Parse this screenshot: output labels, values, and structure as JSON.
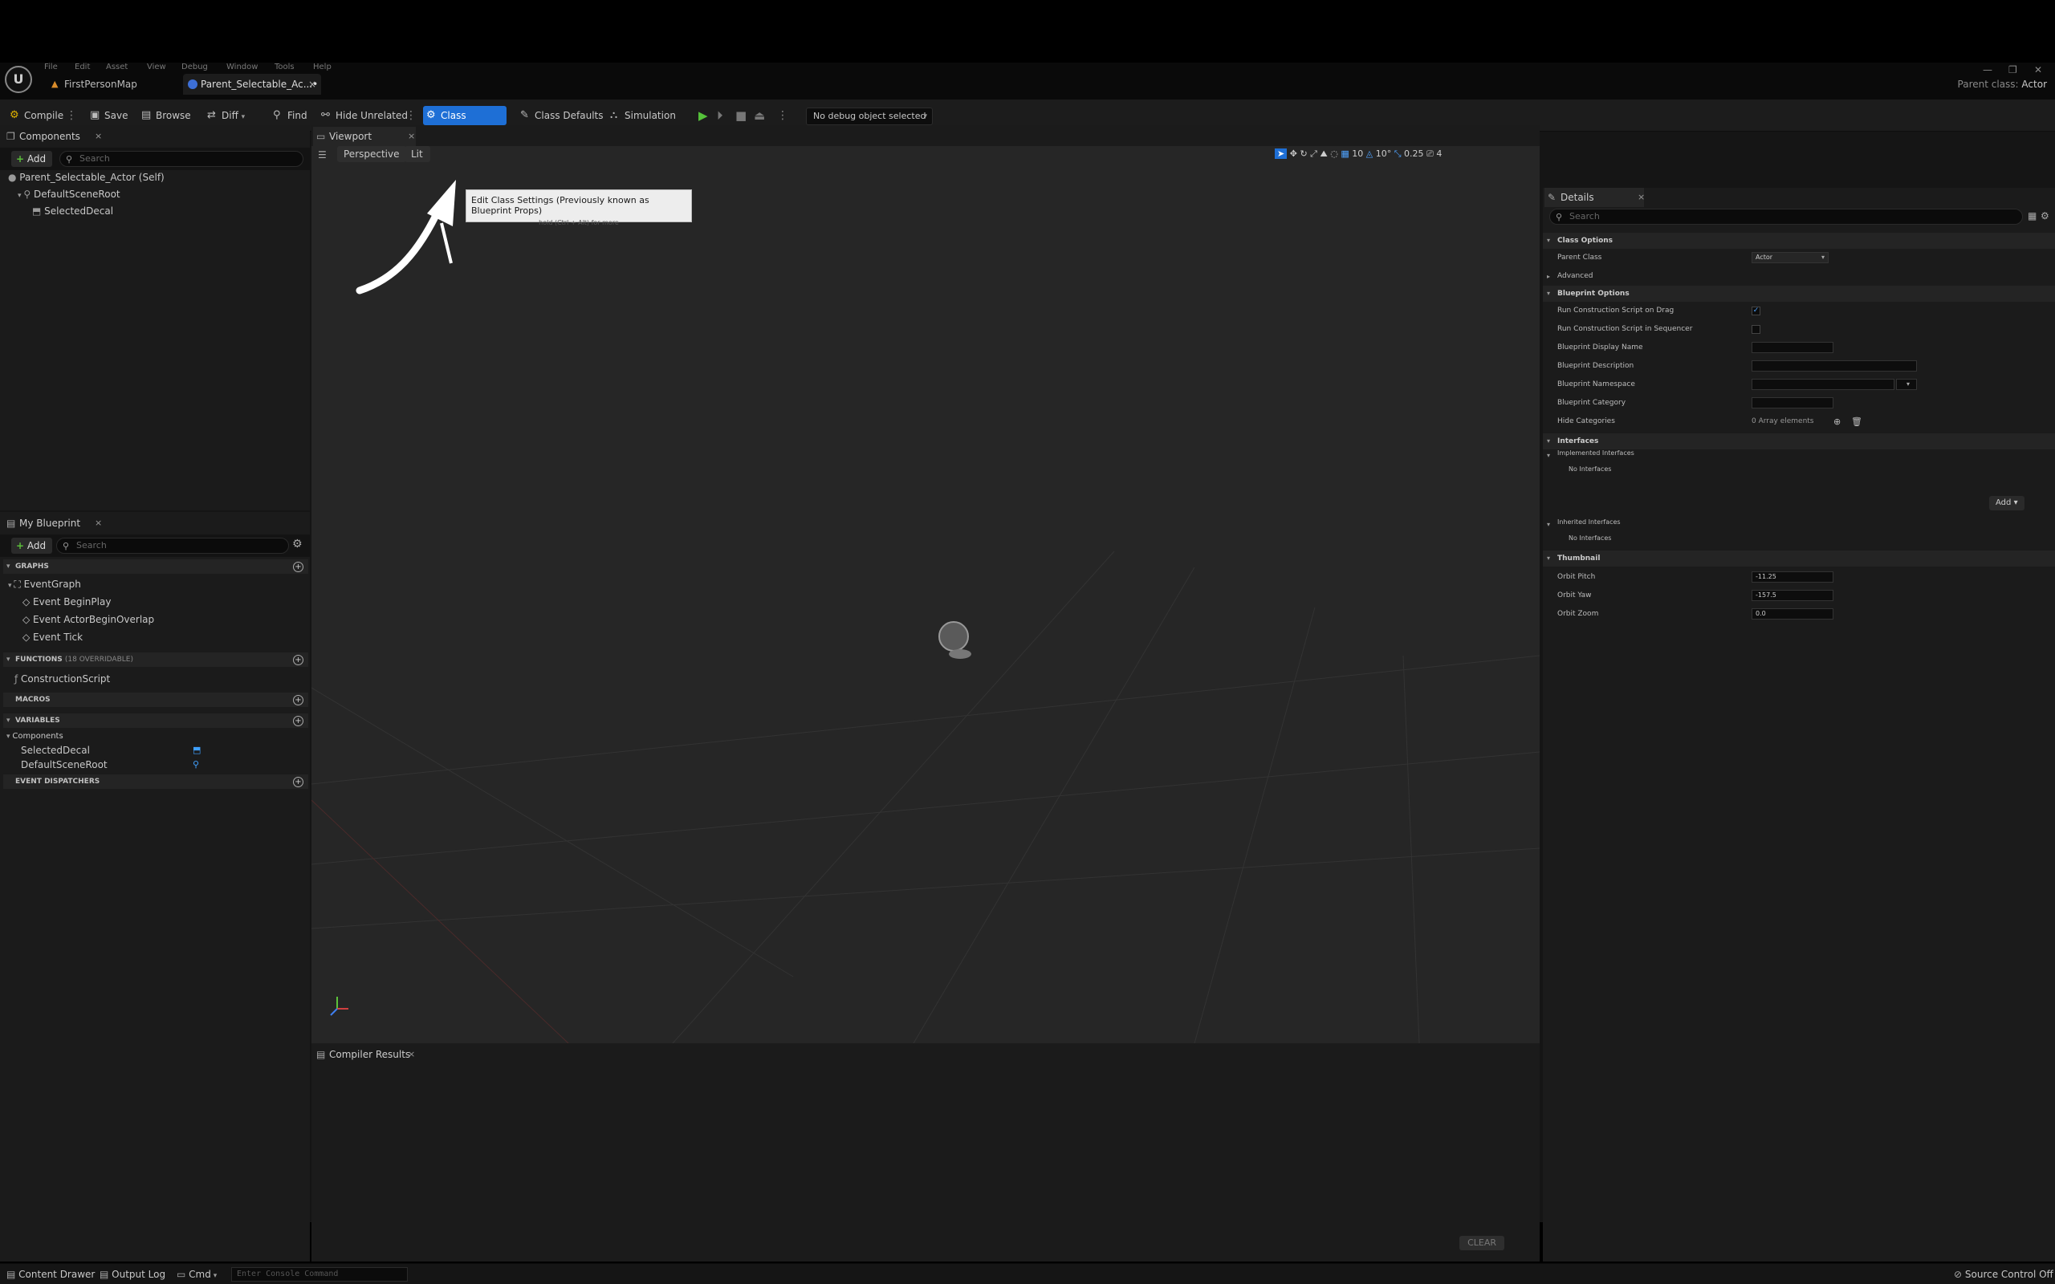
{
  "menu": [
    "File",
    "Edit",
    "Asset",
    "View",
    "Debug",
    "Window",
    "Tools",
    "Help"
  ],
  "tabs": [
    {
      "label": "FirstPersonMap"
    },
    {
      "label": "Parent_Selectable_Ac...•"
    }
  ],
  "window": {
    "minimize": "—",
    "maximize": "❐",
    "close": "✕"
  },
  "parent_class": {
    "label": "Parent class:",
    "value": "Actor"
  },
  "toolbar": {
    "compile": "Compile",
    "save": "Save",
    "browse": "Browse",
    "diff": "Diff",
    "find": "Find",
    "hide_unrelated": "Hide Unrelated",
    "class_settings": "Class Settings",
    "class_defaults": "Class Defaults",
    "simulation": "Simulation",
    "debug_select": "No debug object selected"
  },
  "tooltip": {
    "title": "Edit Class Settings (Previously known as Blueprint Props)",
    "hint": "hold (Ctrl + Alt) for more"
  },
  "components": {
    "tab": "Components",
    "add": "Add",
    "search_placeholder": "Search",
    "items": [
      "Parent_Selectable_Actor (Self)",
      "DefaultSceneRoot",
      "SelectedDecal"
    ]
  },
  "my_blueprint": {
    "tab": "My Blueprint",
    "add": "Add",
    "search_placeholder": "Search",
    "graphs": "GRAPHS",
    "event_graph": "EventGraph",
    "events": [
      "Event BeginPlay",
      "Event ActorBeginOverlap",
      "Event Tick"
    ],
    "functions": "FUNCTIONS",
    "functions_sub": "(18 OVERRIDABLE)",
    "construction": "ConstructionScript",
    "macros": "MACROS",
    "variables": "VARIABLES",
    "components_group": "Components",
    "vars": [
      "SelectedDecal",
      "DefaultSceneRoot"
    ],
    "dispatchers": "EVENT DISPATCHERS"
  },
  "viewport": {
    "tab": "Viewport",
    "perspective": "Perspective",
    "lit": "Lit",
    "grid_snap": "10",
    "rot_snap": "10°",
    "scale_snap": "0.25",
    "cam_speed": "4"
  },
  "compiler": {
    "tab": "Compiler Results",
    "clear": "CLEAR"
  },
  "details": {
    "tab": "Details",
    "search_placeholder": "Search",
    "class_options": "Class Options",
    "parent_class_label": "Parent Class",
    "parent_class_value": "Actor",
    "advanced": "Advanced",
    "blueprint_options": "Blueprint Options",
    "bp_rows": [
      "Run Construction Script on Drag",
      "Run Construction Script in Sequencer",
      "Blueprint Display Name",
      "Blueprint Description",
      "Blueprint Namespace",
      "Blueprint Category",
      "Hide Categories"
    ],
    "array_elements": "0 Array elements",
    "interfaces": "Interfaces",
    "implemented": "Implemented Interfaces",
    "no_interfaces": "No Interfaces",
    "add": "Add",
    "inherited": "Inherited Interfaces",
    "thumbnail": "Thumbnail",
    "orbit_pitch_label": "Orbit Pitch",
    "orbit_pitch": "-11.25",
    "orbit_yaw_label": "Orbit Yaw",
    "orbit_yaw": "-157.5",
    "orbit_zoom_label": "Orbit Zoom",
    "orbit_zoom": "0.0"
  },
  "status": {
    "content_drawer": "Content Drawer",
    "output_log": "Output Log",
    "cmd": "Cmd",
    "console_placeholder": "Enter Console Command",
    "source_control": "Source Control Off"
  }
}
